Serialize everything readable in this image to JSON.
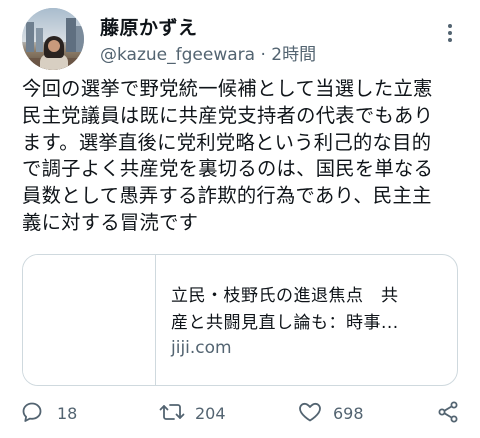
{
  "tweet": {
    "author_name": "藤原かずえ",
    "handle": "@kazue_fgeewara",
    "separator": "·",
    "time": "2時間",
    "text": "今回の選挙で野党統一候補として当選した立憲\n民主党議員は既に共産党支持者の代表でもあり\nます。選挙直後に党利党略という利己的な目的\nで調子よく共産党を裏切るのは、国民を単なる\n員数として愚弄する詐欺的行為であり、民主主\n義に対する冒涜です"
  },
  "link_card": {
    "title": "立民・枝野氏の進退焦点　共\n産と共闘見直し論も：時事...",
    "domain": "jiji.com"
  },
  "actions": {
    "reply_count": "18",
    "retweet_count": "204",
    "like_count": "698"
  },
  "icons": [
    "more-icon",
    "reply-icon",
    "retweet-icon",
    "like-icon",
    "share-icon"
  ],
  "colors": {
    "text": "#0f1419",
    "secondary": "#536471",
    "border": "#cfd9de"
  }
}
